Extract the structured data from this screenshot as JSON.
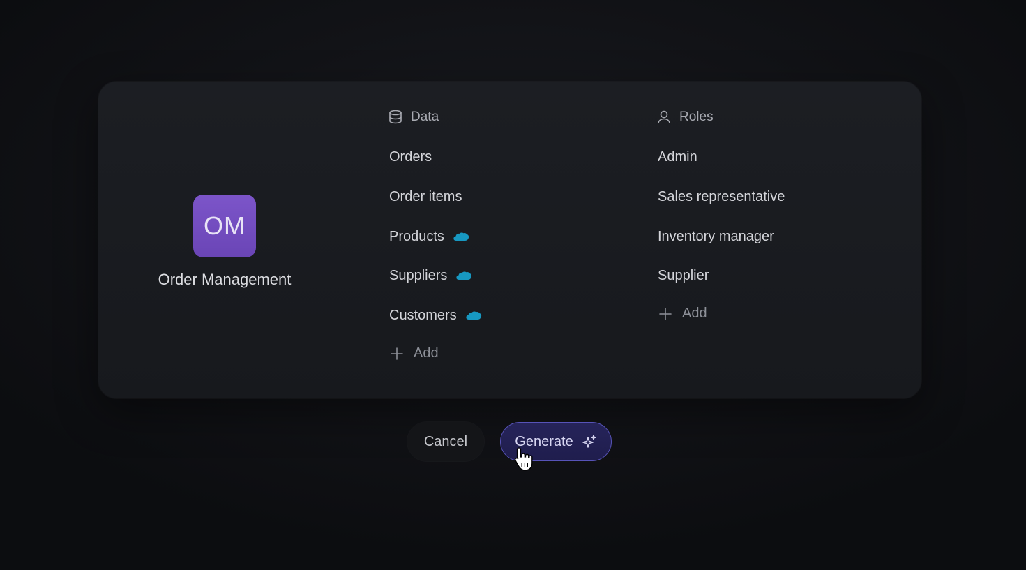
{
  "app": {
    "initials": "OM",
    "name": "Order Management",
    "logo_color": "#7450c2"
  },
  "data_column": {
    "header": "Data",
    "icon": "database-icon",
    "items": [
      {
        "label": "Orders",
        "integration_icon": null
      },
      {
        "label": "Order items",
        "integration_icon": null
      },
      {
        "label": "Products",
        "integration_icon": "salesforce-cloud-icon"
      },
      {
        "label": "Suppliers",
        "integration_icon": "salesforce-cloud-icon"
      },
      {
        "label": "Customers",
        "integration_icon": "salesforce-cloud-icon"
      }
    ],
    "add_label": "Add"
  },
  "roles_column": {
    "header": "Roles",
    "icon": "user-icon",
    "items": [
      {
        "label": "Admin"
      },
      {
        "label": "Sales representative"
      },
      {
        "label": "Inventory manager"
      },
      {
        "label": "Supplier"
      }
    ],
    "add_label": "Add"
  },
  "actions": {
    "cancel_label": "Cancel",
    "generate_label": "Generate",
    "generate_icon": "sparkle-icon",
    "accent_color": "#5753b8"
  },
  "colors": {
    "salesforce_blue": "#1798c1"
  }
}
